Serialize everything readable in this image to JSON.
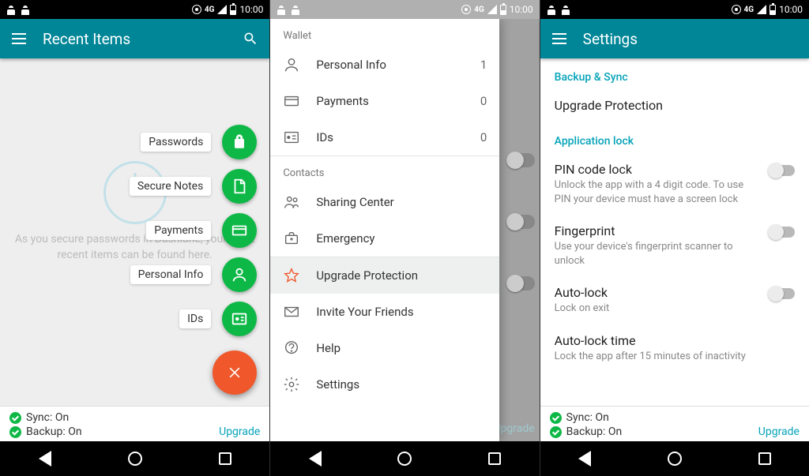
{
  "status": {
    "time": "10:00",
    "net": "4G"
  },
  "screen1": {
    "title": "Recent Items",
    "empty_hint": "As you secure passwords in Dashlane, your most recent items can be found here.",
    "fab": {
      "passwords": "Passwords",
      "notes": "Secure Notes",
      "payments": "Payments",
      "personal": "Personal Info",
      "ids": "IDs"
    },
    "sync": "Sync: On",
    "backup": "Backup: On",
    "upgrade": "Upgrade"
  },
  "screen2": {
    "wallet_header": "Wallet",
    "contacts_header": "Contacts",
    "items": {
      "personal_info": {
        "label": "Personal Info",
        "count": "1"
      },
      "payments": {
        "label": "Payments",
        "count": "0"
      },
      "ids": {
        "label": "IDs",
        "count": "0"
      },
      "sharing": {
        "label": "Sharing Center"
      },
      "emergency": {
        "label": "Emergency"
      },
      "upgrade_protection": {
        "label": "Upgrade Protection"
      },
      "invite": {
        "label": "Invite Your Friends"
      },
      "help": {
        "label": "Help"
      },
      "settings": {
        "label": "Settings"
      }
    },
    "bg_upgrade": "Upgrade"
  },
  "screen3": {
    "title": "Settings",
    "sec_backup": "Backup & Sync",
    "upgrade_protection": "Upgrade Protection",
    "sec_applock": "Application lock",
    "pin": {
      "title": "PIN code lock",
      "sub": "Unlock the app with a 4 digit code. To use PIN your device must have a screen lock"
    },
    "fingerprint": {
      "title": "Fingerprint",
      "sub": "Use your device's fingerprint scanner to unlock"
    },
    "autolock": {
      "title": "Auto-lock",
      "sub": "Lock on exit"
    },
    "autolock_time": {
      "title": "Auto-lock time",
      "sub": "Lock the app after 15 minutes of inactivity"
    },
    "sync": "Sync: On",
    "backup": "Backup: On",
    "upgrade": "Upgrade"
  }
}
